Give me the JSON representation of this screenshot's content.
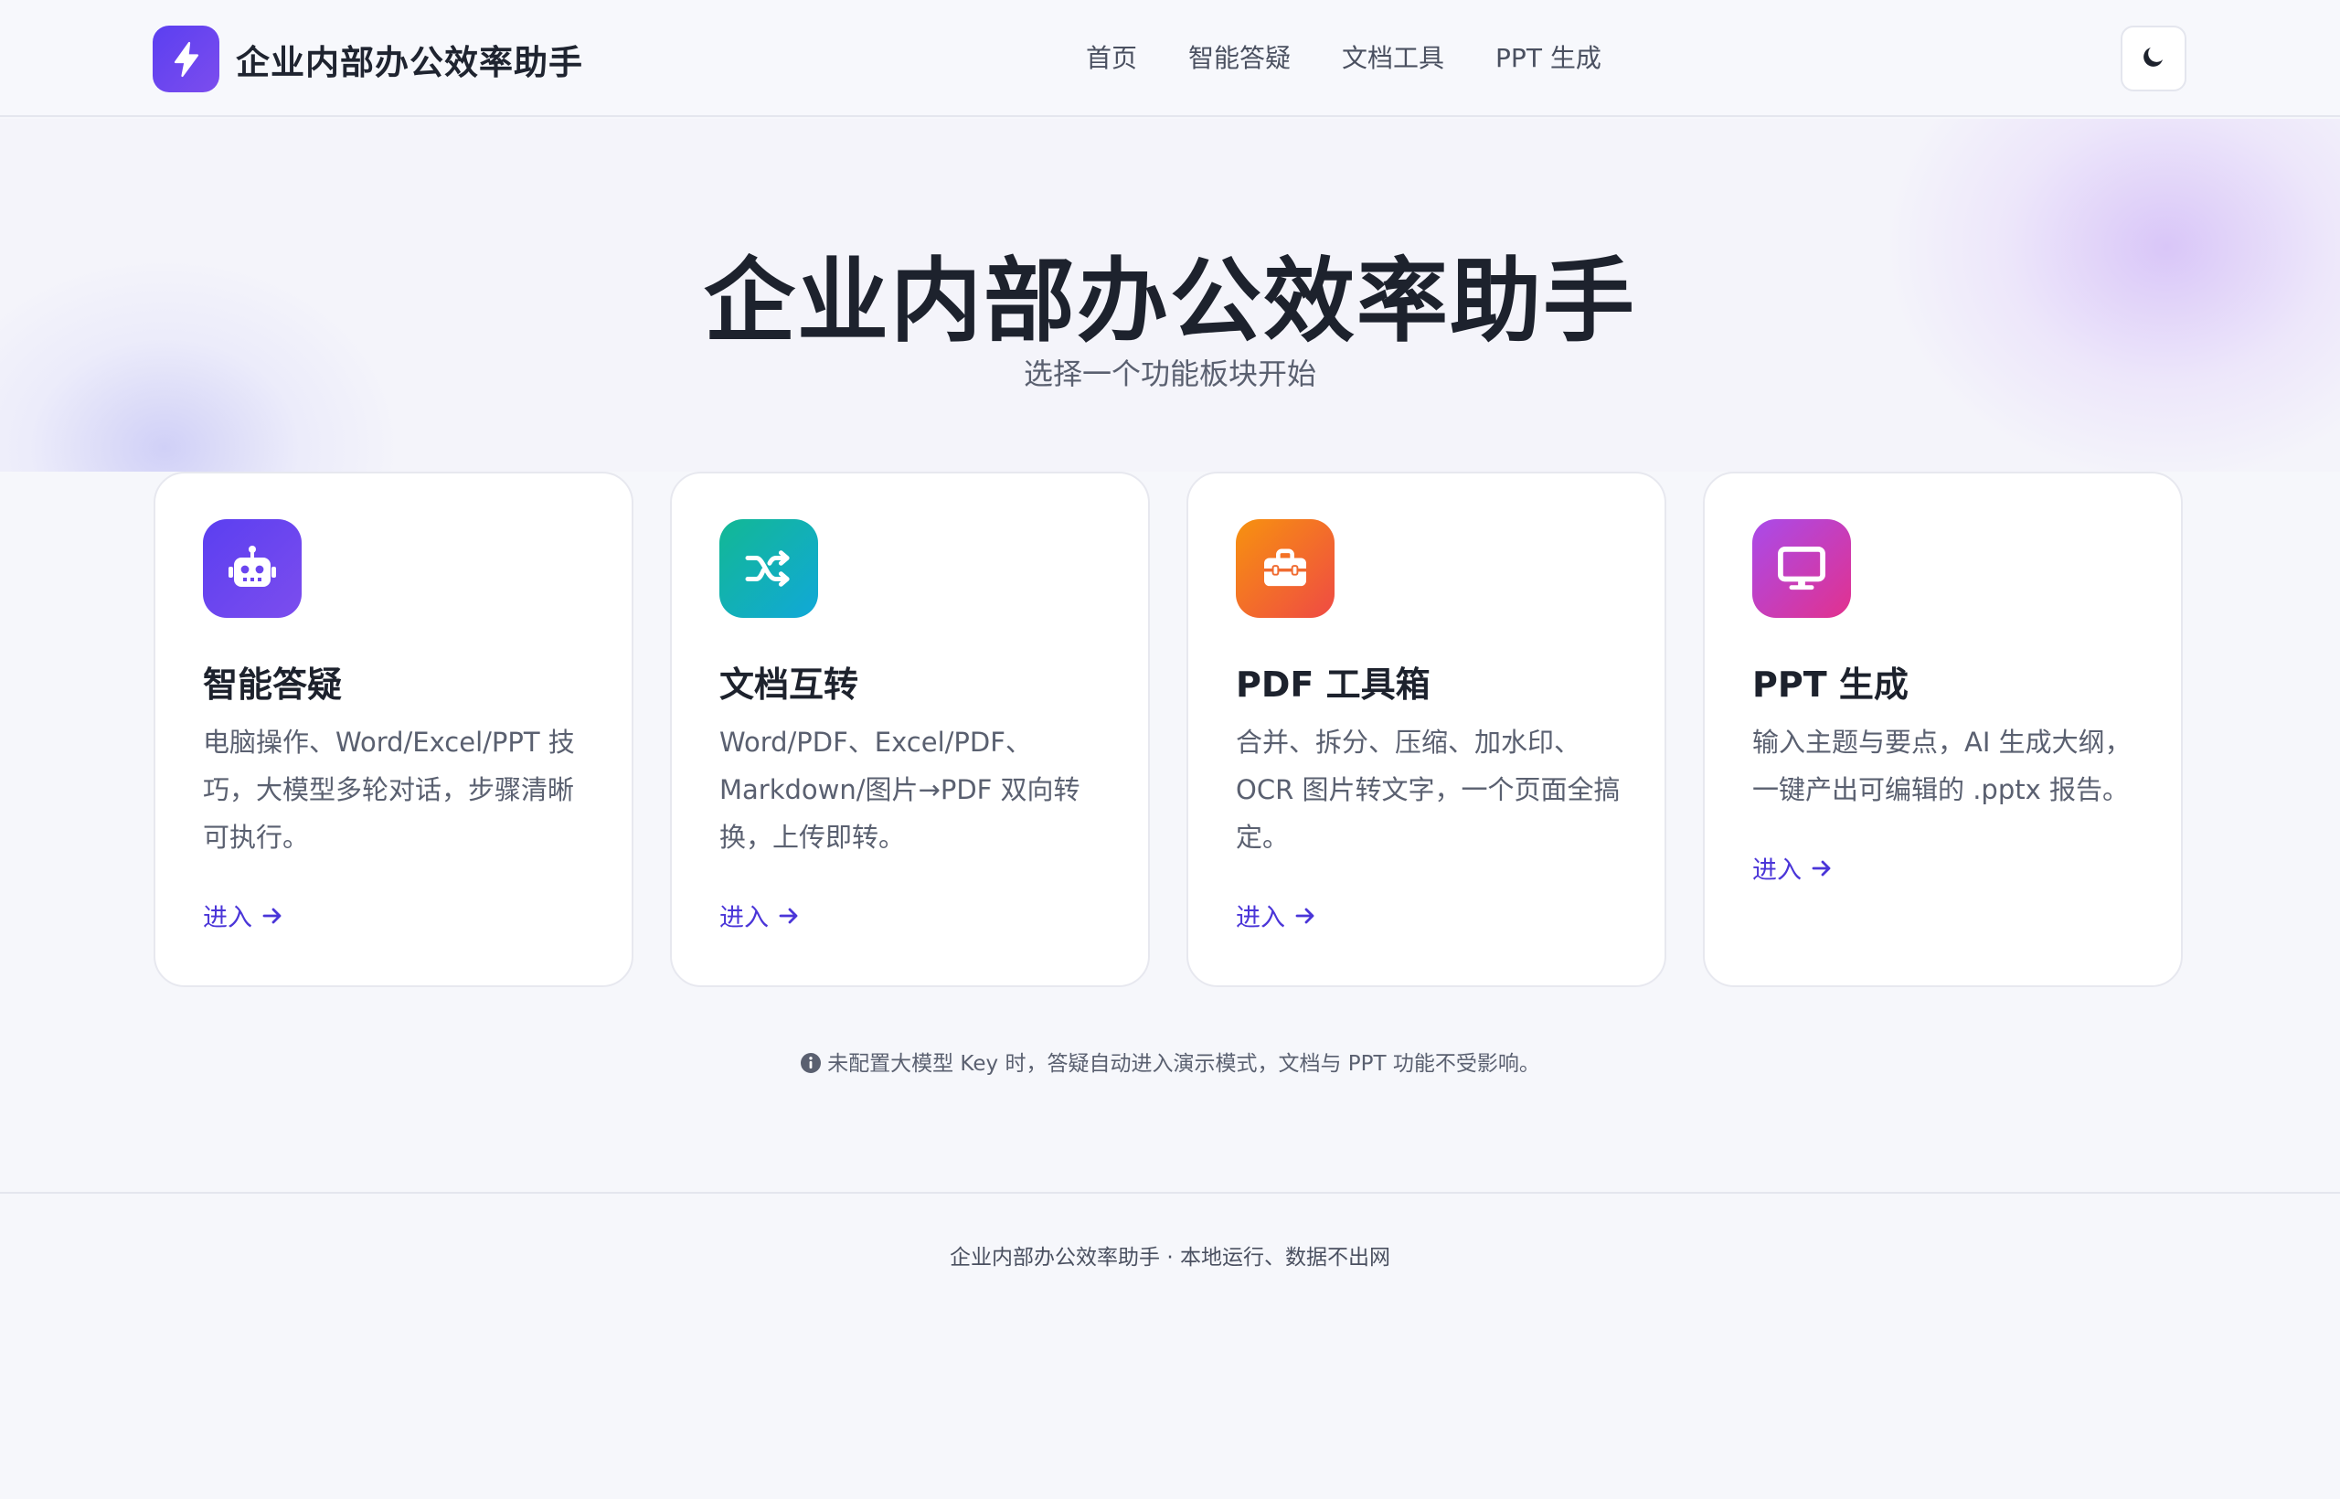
{
  "header": {
    "brand_name": "企业内部办公效率助手",
    "nav": [
      {
        "label": "首页"
      },
      {
        "label": "智能答疑"
      },
      {
        "label": "文档工具"
      },
      {
        "label": "PPT 生成"
      }
    ],
    "theme_toggle_icon": "moon-icon"
  },
  "hero": {
    "title": "企业内部办公效率助手",
    "subtitle": "选择一个功能板块开始"
  },
  "cards": [
    {
      "icon": "robot-icon",
      "title": "智能答疑",
      "desc": "电脑操作、Word/Excel/PPT 技巧，大模型多轮对话，步骤清晰可执行。",
      "link": "进入"
    },
    {
      "icon": "shuffle-icon",
      "title": "文档互转",
      "desc": "Word/PDF、Excel/PDF、Markdown/图片→PDF 双向转换，上传即转。",
      "link": "进入"
    },
    {
      "icon": "toolbox-icon",
      "title": "PDF 工具箱",
      "desc": "合并、拆分、压缩、加水印、OCR 图片转文字，一个页面全搞定。",
      "link": "进入"
    },
    {
      "icon": "monitor-icon",
      "title": "PPT 生成",
      "desc": "输入主题与要点，AI 生成大纲，一键产出可编辑的 .pptx 报告。",
      "link": "进入"
    }
  ],
  "notice": {
    "icon": "info-icon",
    "text": "未配置大模型 Key 时，答疑自动进入演示模式，文档与 PPT 功能不受影响。"
  },
  "footer": {
    "text": "企业内部办公效率助手 · 本地运行、数据不出网"
  },
  "colors": {
    "accent": "#4a35d8",
    "brand_gradient": [
      "#5b3ff0",
      "#7c4dee"
    ],
    "card_teal": [
      "#12b894",
      "#11a8d8"
    ],
    "card_orange": [
      "#f7920f",
      "#ef4a44"
    ],
    "card_pink": [
      "#a94bea",
      "#e2318e"
    ]
  }
}
